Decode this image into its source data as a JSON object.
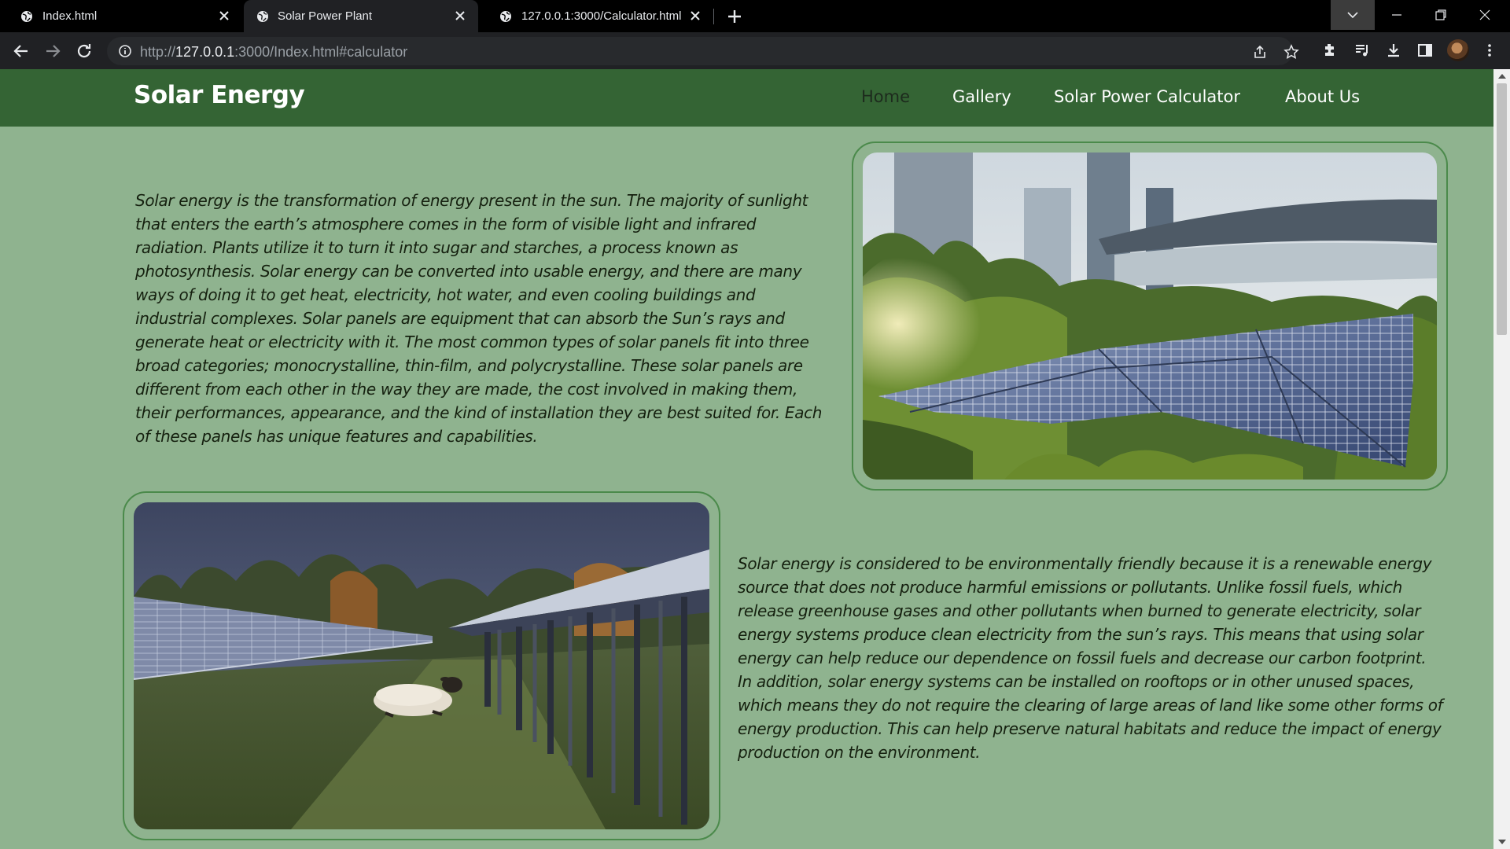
{
  "browser": {
    "tabs": [
      {
        "title": "Index.html"
      },
      {
        "title": "Solar Power Plant"
      },
      {
        "title": "127.0.0.1:3000/Calculator.html"
      }
    ],
    "url": {
      "scheme": "http://",
      "host": "127.0.0.1",
      "rest": ":3000/Index.html#calculator"
    }
  },
  "site": {
    "brand": "Solar Energy",
    "nav": [
      "Home",
      "Gallery",
      "Solar Power Calculator",
      "About Us"
    ],
    "section1": {
      "text": "Solar energy is the transformation of energy present in the sun. The majority of sunlight that enters the earth’s atmosphere comes in the form of visible light and infrared radiation. Plants utilize it to turn it into sugar and starches, a process known as photosynthesis. Solar energy can be converted into usable energy, and there are many ways of doing it to get heat, electricity, hot water, and even cooling buildings and industrial complexes. Solar panels are equipment that can absorb the Sun’s rays and generate heat or electricity with it. The most common types of solar panels fit into three broad categories; monocrystalline, thin-film, and polycrystalline. These solar panels are different from each other in the way they are made, the cost involved in making them, their performances, appearance, and the kind of installation they are best suited for. Each of these panels has unique features and capabilities."
    },
    "section2": {
      "text1": "Solar energy is considered to be environmentally friendly because it is a renewable energy source that does not produce harmful emissions or pollutants. Unlike fossil fuels, which release greenhouse gases and other pollutants when burned to generate electricity, solar energy systems produce clean electricity from the sun’s rays. This means that using solar energy can help reduce our dependence on fossil fuels and decrease our carbon footprint.",
      "text2": "In addition, solar energy systems can be installed on rooftops or in other unused spaces, which means they do not require the clearing of large areas of land like some other forms of energy production. This can help preserve natural habitats and reduce the impact of energy production on the environment."
    }
  },
  "colors": {
    "nav_bg": "#346434",
    "page_bg": "#8fb38f",
    "frame_border": "#4b8a4b",
    "text": "#15200f"
  },
  "icons": [
    "globe-icon",
    "close-icon",
    "plus-icon",
    "back-icon",
    "forward-icon",
    "reload-icon",
    "info-icon",
    "share-icon",
    "star-icon",
    "extensions-icon",
    "media-icon",
    "download-icon",
    "sidepanel-icon",
    "menu-icon"
  ]
}
